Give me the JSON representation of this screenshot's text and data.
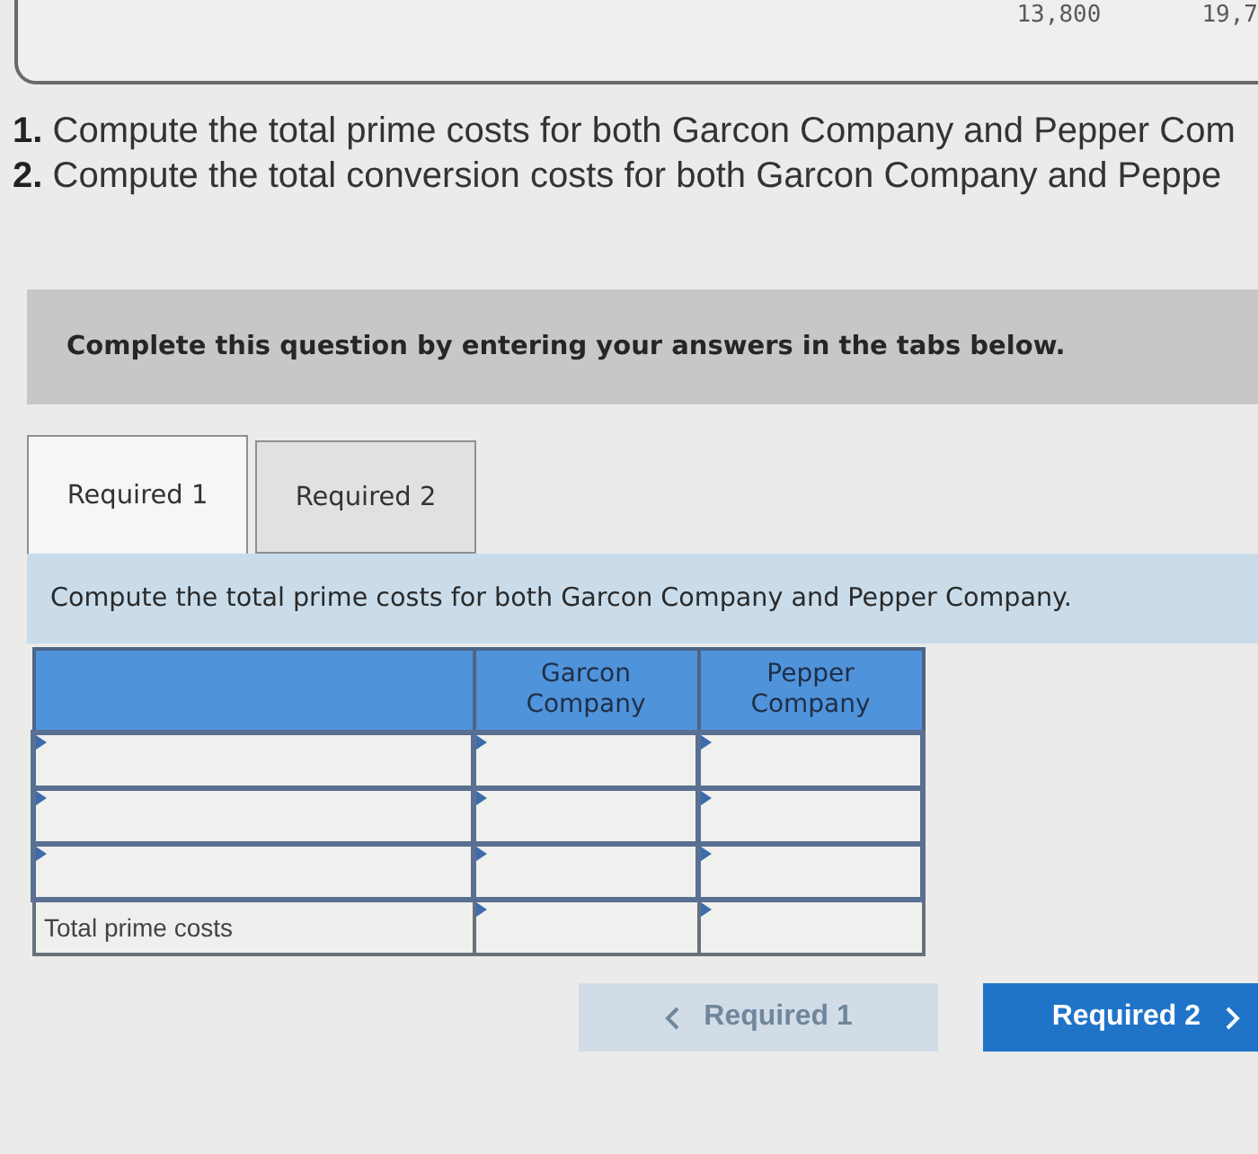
{
  "top_panel": {
    "values": [
      "13,800",
      "19,7"
    ]
  },
  "instructions": [
    {
      "number": "1.",
      "text": "Compute the total prime costs for both Garcon Company and Pepper Com"
    },
    {
      "number": "2.",
      "text": "Compute the total conversion costs for both Garcon Company and Peppe"
    }
  ],
  "banner": {
    "text": "Complete this question by entering your answers in the tabs below."
  },
  "tabs": [
    {
      "label": "Required 1",
      "selected": true
    },
    {
      "label": "Required 2",
      "selected": false
    }
  ],
  "prompt": "Compute the total prime costs for both Garcon Company and Pepper Company.",
  "table": {
    "columns": [
      "Garcon Company",
      "Pepper Company"
    ],
    "rows": [
      {
        "kind": "entry"
      },
      {
        "kind": "entry"
      },
      {
        "kind": "entry"
      },
      {
        "kind": "total",
        "label": "Total prime costs"
      }
    ]
  },
  "nav_buttons": [
    {
      "kind": "prev",
      "label": "Required 1",
      "disabled": true
    },
    {
      "kind": "next",
      "label": "Required 2",
      "disabled": false
    }
  ]
}
